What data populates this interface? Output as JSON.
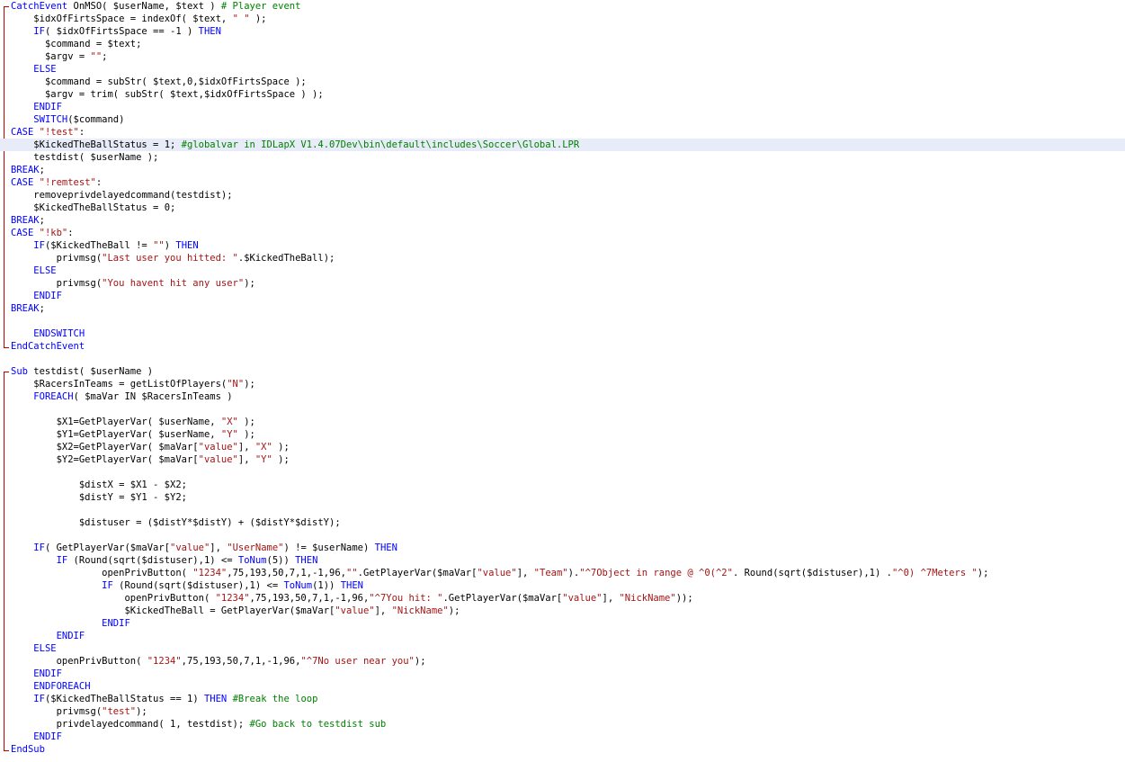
{
  "editor": {
    "current_line": 11,
    "colors": {
      "keyword": "#0000ff",
      "string": "#a31515",
      "comment": "#008000",
      "text": "#000000",
      "fold_marker": "#c00000",
      "current_line_bg": "#e8ecf8"
    },
    "lines": [
      {
        "indent": "",
        "tokens": [
          [
            "kw",
            "CatchEvent"
          ],
          [
            "txt",
            " OnMSO( $userName, $text ) "
          ],
          [
            "cmt",
            "# Player event"
          ]
        ]
      },
      {
        "indent": "    ",
        "tokens": [
          [
            "txt",
            "$idxOfFirtsSpace = indexOf( $text, "
          ],
          [
            "str",
            "\" \""
          ],
          [
            "txt",
            " );"
          ]
        ]
      },
      {
        "indent": "    ",
        "tokens": [
          [
            "kw",
            "IF"
          ],
          [
            "txt",
            "( $idxOfFirtsSpace == -1 ) "
          ],
          [
            "kw",
            "THEN"
          ]
        ]
      },
      {
        "indent": "      ",
        "tokens": [
          [
            "txt",
            "$command = $text;"
          ]
        ]
      },
      {
        "indent": "      ",
        "tokens": [
          [
            "txt",
            "$argv = "
          ],
          [
            "str",
            "\"\""
          ],
          [
            "txt",
            ";"
          ]
        ]
      },
      {
        "indent": "    ",
        "tokens": [
          [
            "kw",
            "ELSE"
          ]
        ]
      },
      {
        "indent": "      ",
        "tokens": [
          [
            "txt",
            "$command = subStr( $text,0,$idxOfFirtsSpace );"
          ]
        ]
      },
      {
        "indent": "      ",
        "tokens": [
          [
            "txt",
            "$argv = trim( subStr( $text,$idxOfFirtsSpace ) );"
          ]
        ]
      },
      {
        "indent": "    ",
        "tokens": [
          [
            "kw",
            "ENDIF"
          ]
        ]
      },
      {
        "indent": "    ",
        "tokens": [
          [
            "kw",
            "SWITCH"
          ],
          [
            "txt",
            "($command)"
          ]
        ]
      },
      {
        "indent": "",
        "tokens": [
          [
            "kw",
            "CASE"
          ],
          [
            "txt",
            " "
          ],
          [
            "str",
            "\"!test\""
          ],
          [
            "txt",
            ":"
          ]
        ]
      },
      {
        "indent": "    ",
        "tokens": [
          [
            "txt",
            "$KickedTheBallStatus = 1; "
          ],
          [
            "cmt",
            "#globalvar in IDLapX V1.4.07Dev\\bin\\default\\includes\\Soccer\\Global.LPR"
          ]
        ]
      },
      {
        "indent": "    ",
        "tokens": [
          [
            "txt",
            "testdist( $userName );"
          ]
        ]
      },
      {
        "indent": "",
        "tokens": [
          [
            "kw",
            "BREAK"
          ],
          [
            "txt",
            ";"
          ]
        ]
      },
      {
        "indent": "",
        "tokens": [
          [
            "kw",
            "CASE"
          ],
          [
            "txt",
            " "
          ],
          [
            "str",
            "\"!remtest\""
          ],
          [
            "txt",
            ":"
          ]
        ]
      },
      {
        "indent": "    ",
        "tokens": [
          [
            "txt",
            "removeprivdelayedcommand(testdist);"
          ]
        ]
      },
      {
        "indent": "    ",
        "tokens": [
          [
            "txt",
            "$KickedTheBallStatus = 0;"
          ]
        ]
      },
      {
        "indent": "",
        "tokens": [
          [
            "kw",
            "BREAK"
          ],
          [
            "txt",
            ";"
          ]
        ]
      },
      {
        "indent": "",
        "tokens": [
          [
            "kw",
            "CASE"
          ],
          [
            "txt",
            " "
          ],
          [
            "str",
            "\"!kb\""
          ],
          [
            "txt",
            ":"
          ]
        ]
      },
      {
        "indent": "    ",
        "tokens": [
          [
            "kw",
            "IF"
          ],
          [
            "txt",
            "($KickedTheBall != "
          ],
          [
            "str",
            "\"\""
          ],
          [
            "txt",
            ") "
          ],
          [
            "kw",
            "THEN"
          ]
        ]
      },
      {
        "indent": "        ",
        "tokens": [
          [
            "txt",
            "privmsg("
          ],
          [
            "str",
            "\"Last user you hitted: \""
          ],
          [
            "txt",
            ".$KickedTheBall);"
          ]
        ]
      },
      {
        "indent": "    ",
        "tokens": [
          [
            "kw",
            "ELSE"
          ]
        ]
      },
      {
        "indent": "        ",
        "tokens": [
          [
            "txt",
            "privmsg("
          ],
          [
            "str",
            "\"You havent hit any user\""
          ],
          [
            "txt",
            ");"
          ]
        ]
      },
      {
        "indent": "    ",
        "tokens": [
          [
            "kw",
            "ENDIF"
          ]
        ]
      },
      {
        "indent": "",
        "tokens": [
          [
            "kw",
            "BREAK"
          ],
          [
            "txt",
            ";"
          ]
        ]
      },
      {
        "indent": "",
        "tokens": []
      },
      {
        "indent": "    ",
        "tokens": [
          [
            "kw",
            "ENDSWITCH"
          ]
        ]
      },
      {
        "indent": "",
        "tokens": [
          [
            "kw",
            "EndCatchEvent"
          ]
        ]
      },
      {
        "indent": "",
        "tokens": []
      },
      {
        "indent": "",
        "tokens": [
          [
            "kw",
            "Sub"
          ],
          [
            "txt",
            " testdist( $userName )"
          ]
        ]
      },
      {
        "indent": "    ",
        "tokens": [
          [
            "txt",
            "$RacersInTeams = getListOfPlayers("
          ],
          [
            "str",
            "\"N\""
          ],
          [
            "txt",
            ");"
          ]
        ]
      },
      {
        "indent": "    ",
        "tokens": [
          [
            "kw",
            "FOREACH"
          ],
          [
            "txt",
            "( $maVar IN $RacersInTeams )"
          ]
        ]
      },
      {
        "indent": "",
        "tokens": []
      },
      {
        "indent": "        ",
        "tokens": [
          [
            "txt",
            "$X1=GetPlayerVar( $userName, "
          ],
          [
            "str",
            "\"X\""
          ],
          [
            "txt",
            " );"
          ]
        ]
      },
      {
        "indent": "        ",
        "tokens": [
          [
            "txt",
            "$Y1=GetPlayerVar( $userName, "
          ],
          [
            "str",
            "\"Y\""
          ],
          [
            "txt",
            " );"
          ]
        ]
      },
      {
        "indent": "        ",
        "tokens": [
          [
            "txt",
            "$X2=GetPlayerVar( $maVar["
          ],
          [
            "str",
            "\"value\""
          ],
          [
            "txt",
            "], "
          ],
          [
            "str",
            "\"X\""
          ],
          [
            "txt",
            " );"
          ]
        ]
      },
      {
        "indent": "        ",
        "tokens": [
          [
            "txt",
            "$Y2=GetPlayerVar( $maVar["
          ],
          [
            "str",
            "\"value\""
          ],
          [
            "txt",
            "], "
          ],
          [
            "str",
            "\"Y\""
          ],
          [
            "txt",
            " );"
          ]
        ]
      },
      {
        "indent": "",
        "tokens": []
      },
      {
        "indent": "            ",
        "tokens": [
          [
            "txt",
            "$distX = $X1 - $X2;"
          ]
        ]
      },
      {
        "indent": "            ",
        "tokens": [
          [
            "txt",
            "$distY = $Y1 - $Y2;"
          ]
        ]
      },
      {
        "indent": "",
        "tokens": []
      },
      {
        "indent": "            ",
        "tokens": [
          [
            "txt",
            "$distuser = ($distY*$distY) + ($distY*$distY);"
          ]
        ]
      },
      {
        "indent": "",
        "tokens": []
      },
      {
        "indent": "    ",
        "tokens": [
          [
            "kw",
            "IF"
          ],
          [
            "txt",
            "( GetPlayerVar($maVar["
          ],
          [
            "str",
            "\"value\""
          ],
          [
            "txt",
            "], "
          ],
          [
            "str",
            "\"UserName\""
          ],
          [
            "txt",
            ") != $userName) "
          ],
          [
            "kw",
            "THEN"
          ]
        ]
      },
      {
        "indent": "        ",
        "tokens": [
          [
            "kw",
            "IF"
          ],
          [
            "txt",
            " (Round(sqrt($distuser),1) <= "
          ],
          [
            "kw",
            "ToNum"
          ],
          [
            "txt",
            "(5)) "
          ],
          [
            "kw",
            "THEN"
          ]
        ]
      },
      {
        "indent": "                ",
        "tokens": [
          [
            "txt",
            "openPrivButton( "
          ],
          [
            "str",
            "\"1234\""
          ],
          [
            "txt",
            ",75,193,50,7,1,-1,96,"
          ],
          [
            "str",
            "\"\""
          ],
          [
            "txt",
            ".GetPlayerVar($maVar["
          ],
          [
            "str",
            "\"value\""
          ],
          [
            "txt",
            "], "
          ],
          [
            "str",
            "\"Team\""
          ],
          [
            "txt",
            ")."
          ],
          [
            "str",
            "\"^7Object in range @ ^0(^2\""
          ],
          [
            "txt",
            ". Round(sqrt($distuser),1) ."
          ],
          [
            "str",
            "\"^0) ^7Meters \""
          ],
          [
            "txt",
            ");"
          ]
        ]
      },
      {
        "indent": "                ",
        "tokens": [
          [
            "kw",
            "IF"
          ],
          [
            "txt",
            " (Round(sqrt($distuser),1) <= "
          ],
          [
            "kw",
            "ToNum"
          ],
          [
            "txt",
            "(1)) "
          ],
          [
            "kw",
            "THEN"
          ]
        ]
      },
      {
        "indent": "                    ",
        "tokens": [
          [
            "txt",
            "openPrivButton( "
          ],
          [
            "str",
            "\"1234\""
          ],
          [
            "txt",
            ",75,193,50,7,1,-1,96,"
          ],
          [
            "str",
            "\"^7You hit: \""
          ],
          [
            "txt",
            ".GetPlayerVar($maVar["
          ],
          [
            "str",
            "\"value\""
          ],
          [
            "txt",
            "], "
          ],
          [
            "str",
            "\"NickName\""
          ],
          [
            "txt",
            "));"
          ]
        ]
      },
      {
        "indent": "                    ",
        "tokens": [
          [
            "txt",
            "$KickedTheBall = GetPlayerVar($maVar["
          ],
          [
            "str",
            "\"value\""
          ],
          [
            "txt",
            "], "
          ],
          [
            "str",
            "\"NickName\""
          ],
          [
            "txt",
            ");"
          ]
        ]
      },
      {
        "indent": "                ",
        "tokens": [
          [
            "kw",
            "ENDIF"
          ]
        ]
      },
      {
        "indent": "        ",
        "tokens": [
          [
            "kw",
            "ENDIF"
          ]
        ]
      },
      {
        "indent": "    ",
        "tokens": [
          [
            "kw",
            "ELSE"
          ]
        ]
      },
      {
        "indent": "        ",
        "tokens": [
          [
            "txt",
            "openPrivButton( "
          ],
          [
            "str",
            "\"1234\""
          ],
          [
            "txt",
            ",75,193,50,7,1,-1,96,"
          ],
          [
            "str",
            "\"^7No user near you\""
          ],
          [
            "txt",
            ");"
          ]
        ]
      },
      {
        "indent": "    ",
        "tokens": [
          [
            "kw",
            "ENDIF"
          ]
        ]
      },
      {
        "indent": "    ",
        "tokens": [
          [
            "kw",
            "ENDFOREACH"
          ]
        ]
      },
      {
        "indent": "    ",
        "tokens": [
          [
            "kw",
            "IF"
          ],
          [
            "txt",
            "($KickedTheBallStatus == 1) "
          ],
          [
            "kw",
            "THEN"
          ],
          [
            "txt",
            " "
          ],
          [
            "cmt",
            "#Break the loop"
          ]
        ]
      },
      {
        "indent": "        ",
        "tokens": [
          [
            "txt",
            "privmsg("
          ],
          [
            "str",
            "\"test\""
          ],
          [
            "txt",
            ");"
          ]
        ]
      },
      {
        "indent": "        ",
        "tokens": [
          [
            "txt",
            "privdelayedcommand( 1, testdist); "
          ],
          [
            "cmt",
            "#Go back to testdist sub"
          ]
        ]
      },
      {
        "indent": "    ",
        "tokens": [
          [
            "kw",
            "ENDIF"
          ]
        ]
      },
      {
        "indent": "",
        "tokens": [
          [
            "kw",
            "EndSub"
          ]
        ]
      }
    ]
  }
}
